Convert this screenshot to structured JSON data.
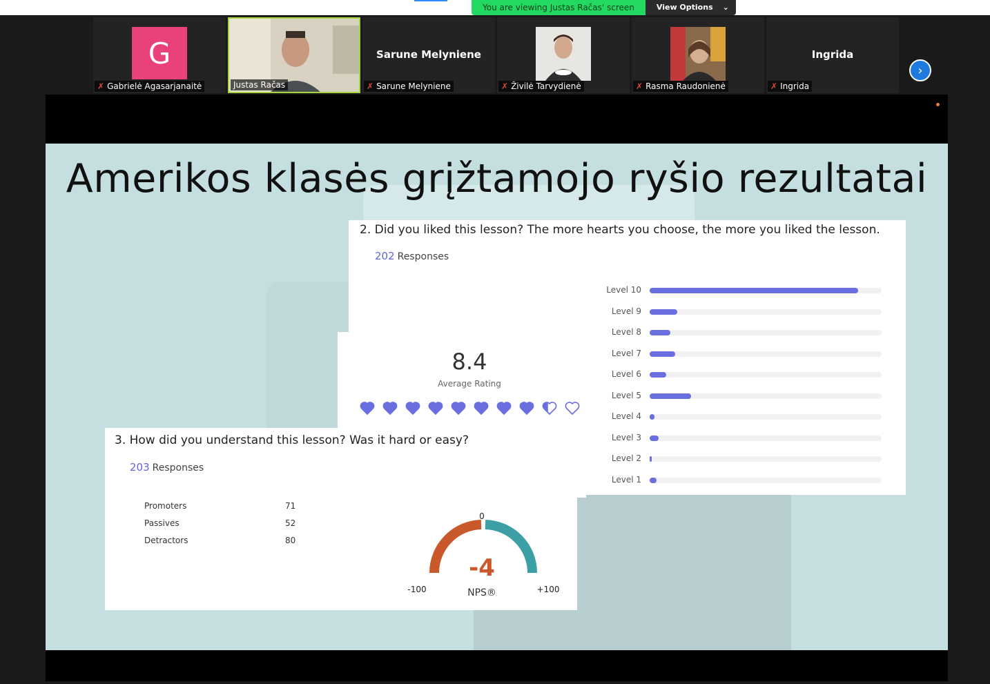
{
  "banner": {
    "viewing_text": "You are viewing Justas Račas' screen",
    "view_options": "View Options",
    "chevron": "⌄"
  },
  "participants": [
    {
      "name": "Gabrielė Agasarjanaitė",
      "initial": "G",
      "muted": true
    },
    {
      "name": "Justas Račas",
      "muted": false,
      "active": true
    },
    {
      "name": "Sarune Melyniene",
      "display": "Sarune Melyniene",
      "muted": true
    },
    {
      "name": "Živilė Tarvydienė",
      "muted": true
    },
    {
      "name": "Rasma Raudonienė",
      "muted": true
    },
    {
      "name": "Ingrida",
      "display": "Ingrida",
      "muted": true
    }
  ],
  "next_icon": "›",
  "slide": {
    "title": "Amerikos klasės grįžtamojo ryšio rezultatai",
    "q2": {
      "title": "2. Did you liked this lesson? The more hearts you choose, the more you liked the lesson.",
      "responses_count": "202",
      "responses_label": "Responses",
      "average": "8.4",
      "average_label": "Average Rating",
      "hearts_filled": 8.4,
      "hearts_total": 10
    },
    "q3": {
      "title": "3. How did you understand this lesson? Was it hard or easy?",
      "responses_count": "203",
      "responses_label": "Responses",
      "stats": [
        {
          "label": "Promoters",
          "value": "71"
        },
        {
          "label": "Passives",
          "value": "52"
        },
        {
          "label": "Detractors",
          "value": "80"
        }
      ],
      "nps_value": "-4",
      "nps_label": "NPS®",
      "gauge_min": "-100",
      "gauge_mid": "0",
      "gauge_max": "+100",
      "colors": {
        "negative": "#c9582a",
        "positive": "#3d9fa6"
      }
    }
  },
  "chart_data": {
    "type": "bar",
    "categories": [
      "Level 10",
      "Level 9",
      "Level 8",
      "Level 7",
      "Level 6",
      "Level 5",
      "Level 4",
      "Level 3",
      "Level 2",
      "Level 1"
    ],
    "values": [
      0.9,
      0.12,
      0.09,
      0.11,
      0.07,
      0.18,
      0.02,
      0.04,
      0.01,
      0.03
    ],
    "orientation": "horizontal",
    "bar_color": "#6a6ee0"
  }
}
